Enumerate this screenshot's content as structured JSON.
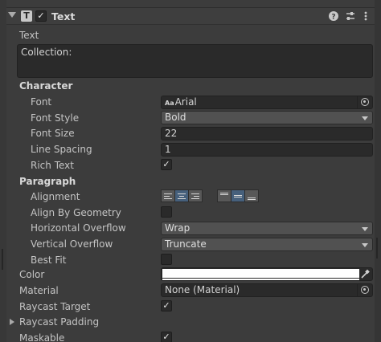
{
  "component": {
    "title": "Text",
    "icon": "text-component-icon",
    "enabled": true
  },
  "text_section": {
    "label": "Text",
    "value": "Collection:"
  },
  "character": {
    "header": "Character",
    "font_label": "Font",
    "font_value": "Arial",
    "font_prefix": "Aa",
    "font_style_label": "Font Style",
    "font_style_value": "Bold",
    "font_size_label": "Font Size",
    "font_size_value": "22",
    "line_spacing_label": "Line Spacing",
    "line_spacing_value": "1",
    "rich_text_label": "Rich Text",
    "rich_text_checked": true
  },
  "paragraph": {
    "header": "Paragraph",
    "alignment_label": "Alignment",
    "horizontal_alignment_selected": "center",
    "vertical_alignment_selected": "middle",
    "align_by_geometry_label": "Align By Geometry",
    "align_by_geometry_checked": false,
    "horizontal_overflow_label": "Horizontal Overflow",
    "horizontal_overflow_value": "Wrap",
    "vertical_overflow_label": "Vertical Overflow",
    "vertical_overflow_value": "Truncate",
    "best_fit_label": "Best Fit",
    "best_fit_checked": false
  },
  "color_label": "Color",
  "color_value": "#ffffff",
  "material_label": "Material",
  "material_value": "None (Material)",
  "raycast_target_label": "Raycast Target",
  "raycast_target_checked": true,
  "raycast_padding_label": "Raycast Padding",
  "maskable_label": "Maskable",
  "maskable_checked": true,
  "colors": {
    "panel": "#3c3c3c",
    "field": "#2a2a2a",
    "dropdown": "#515151",
    "active_toggle": "#46607c"
  }
}
